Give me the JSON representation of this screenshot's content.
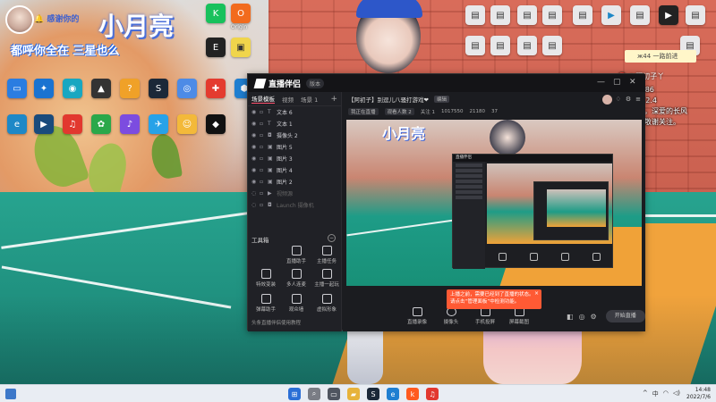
{
  "overlay": {
    "welcome_prefix": "🔔 感谢",
    "welcome_label": "你的",
    "streamer_name": "小月亮",
    "scroll_text": "都呼你全在 三星也么"
  },
  "right_overlay": {
    "sticky_note": "ж44 一路前进",
    "counter": "🔴 ♪ 阿初子丫",
    "chat_lines": [
      "1456488886",
      "Y爷呼46822.4",
      "浅喜似苍狗，深爱的长风",
      "感谢遇见，敬谢关注。"
    ]
  },
  "desktop_icons": [
    {
      "label": "",
      "icon": "avatar-icon",
      "color": "#e5e5e5"
    },
    {
      "label": "Origin",
      "icon": "origin-icon",
      "color": "#f26b1d"
    },
    {
      "label": "Kook",
      "icon": "kook-icon",
      "color": "#18c15c"
    },
    {
      "label": "Steam",
      "icon": "steam-icon",
      "color": "#1b2838"
    },
    {
      "label": "Epic",
      "icon": "epic-icon",
      "color": "#2a2a2a"
    },
    {
      "label": "Edge",
      "icon": "edge-icon",
      "color": "#1e88c7"
    }
  ],
  "app": {
    "name": "直播伴侣",
    "version": "版本",
    "tabs": [
      "场景模板",
      "视频",
      "场景 1"
    ],
    "layers": [
      {
        "name": "文本 6",
        "dim": false
      },
      {
        "name": "文本 1",
        "dim": false
      },
      {
        "name": "摄像头 2",
        "dim": false
      },
      {
        "name": "图片 5",
        "dim": false
      },
      {
        "name": "图片 3",
        "dim": false
      },
      {
        "name": "图片 4",
        "dim": false
      },
      {
        "name": "图片 2",
        "dim": false
      },
      {
        "name": "视频源",
        "dim": true
      },
      {
        "name": "Launch 摄像机",
        "dim": true
      }
    ],
    "tools_title": "工具箱",
    "tools": [
      {
        "label": "直播助手",
        "icon": "assistant-icon"
      },
      {
        "label": "主播任务",
        "icon": "task-icon"
      },
      {
        "label": "特效变装",
        "icon": "effect-icon"
      },
      {
        "label": "多人连麦",
        "icon": "mic-icon"
      },
      {
        "label": "主播一起玩",
        "icon": "play-icon"
      },
      {
        "label": "弹幕助手",
        "icon": "danmaku-icon"
      },
      {
        "label": "观众墙",
        "icon": "wall-icon"
      },
      {
        "label": "虚拟形象",
        "icon": "avatar-tool-icon"
      }
    ],
    "bottom_hint": "头条直播伴侣使用教程",
    "tip": {
      "text": "上播之前，需要已经到了直播的状态。请点击“管理面板”中检测功能。",
      "close": "×"
    },
    "room": {
      "title": "【阿初子】别逗儿八骚打游戏❤",
      "tag": "编辑",
      "stats": [
        "我正在直播",
        "观看人数 2",
        "关注 1",
        "1017550",
        "21180",
        "37"
      ]
    },
    "preview_title": "小月亮",
    "bottom_buttons": [
      {
        "label": "直播录像",
        "icon": "record-icon"
      },
      {
        "label": "摄像头",
        "icon": "camera-icon"
      },
      {
        "label": "手机投屏",
        "icon": "phone-icon"
      },
      {
        "label": "屏幕截图",
        "icon": "screenshot-icon"
      }
    ],
    "start_button": "开始直播"
  },
  "taskbar": {
    "apps": [
      {
        "icon": "start-icon",
        "color": "#2b6fd6"
      },
      {
        "icon": "search-icon",
        "color": "#555"
      },
      {
        "icon": "taskview-icon",
        "color": "#444"
      },
      {
        "icon": "explorer-icon",
        "color": "#e7b33b"
      },
      {
        "icon": "steam-icon",
        "color": "#1b2838"
      },
      {
        "icon": "edge-icon",
        "color": "#1f7fd1"
      },
      {
        "icon": "kuaishou-icon",
        "color": "#ff5a1f"
      },
      {
        "icon": "netease-icon",
        "color": "#e2382f"
      }
    ],
    "time": "14:48",
    "date": "2022/7/6"
  }
}
